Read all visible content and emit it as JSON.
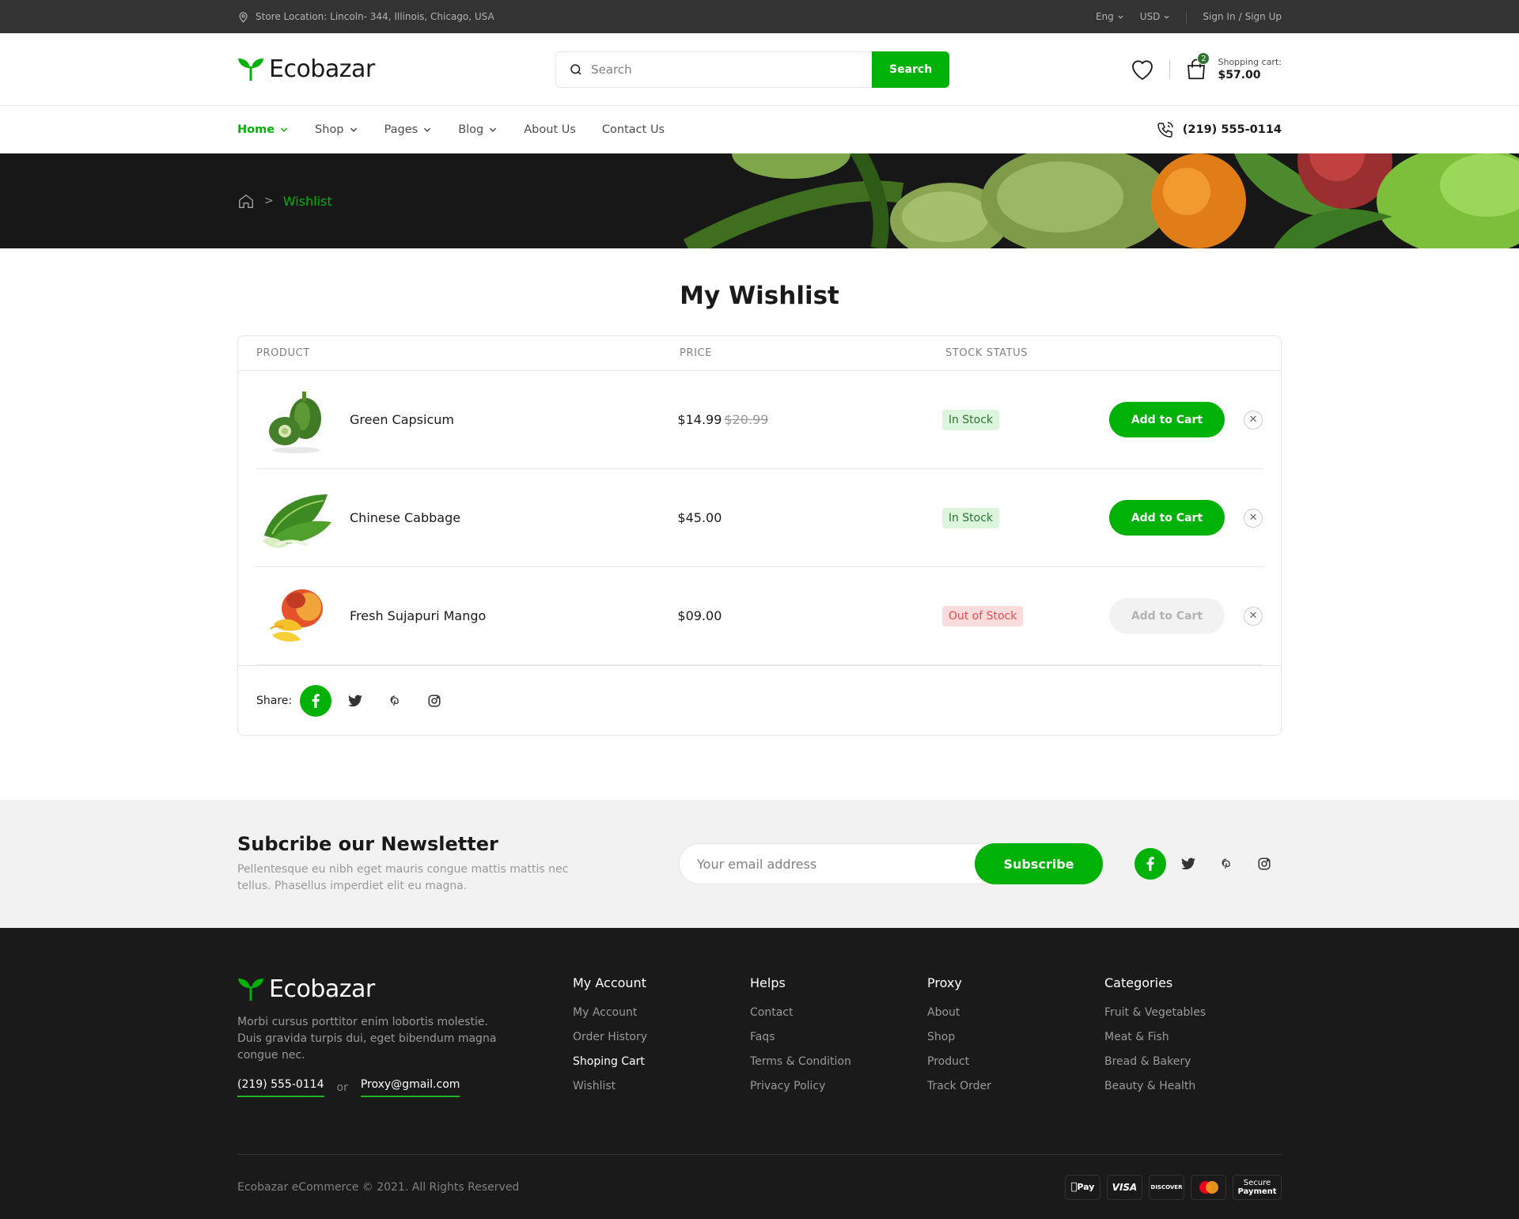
{
  "topbar": {
    "location": "Store Location: Lincoln- 344, Illinois, Chicago, USA",
    "language": "Eng",
    "currency": "USD",
    "sign_in": "Sign In",
    "slash": "/",
    "sign_up": "Sign Up"
  },
  "header": {
    "brand": "Ecobazar",
    "search_placeholder": "Search",
    "search_button": "Search",
    "cart_count": "2",
    "cart_label": "Shopping cart:",
    "cart_amount": "$57.00"
  },
  "nav": {
    "items": [
      {
        "label": "Home",
        "dropdown": true,
        "active": true
      },
      {
        "label": "Shop",
        "dropdown": true
      },
      {
        "label": "Pages",
        "dropdown": true
      },
      {
        "label": "Blog",
        "dropdown": true
      },
      {
        "label": "About Us",
        "dropdown": false
      },
      {
        "label": "Contact Us",
        "dropdown": false
      }
    ],
    "phone": "(219) 555-0114"
  },
  "breadcrumb": {
    "sep": ">",
    "current": "Wishlist"
  },
  "page_title": "My Wishlist",
  "table": {
    "columns": [
      "PRODUCT",
      "PRICE",
      "STOCK STATUS"
    ],
    "rows": [
      {
        "name": "Green Capsicum",
        "price": "$14.99",
        "old_price": "$20.99",
        "stock": "In Stock",
        "action": "Add to Cart"
      },
      {
        "name": "Chinese Cabbage",
        "price": "$45.00",
        "old_price": "",
        "stock": "In Stock",
        "action": "Add to Cart"
      },
      {
        "name": "Fresh Sujapuri Mango",
        "price": "$09.00",
        "old_price": "",
        "stock": "Out of Stock",
        "action": "Add to Cart"
      }
    ],
    "remove_glyph": "✕",
    "share_label": "Share:"
  },
  "newsletter": {
    "title": "Subcribe our Newsletter",
    "text": "Pellentesque eu nibh eget mauris congue mattis mattis nec tellus. Phasellus imperdiet elit eu magna.",
    "placeholder": "Your email address",
    "button": "Subscribe"
  },
  "footer": {
    "brand": "Ecobazar",
    "about": "Morbi cursus porttitor enim lobortis molestie. Duis gravida turpis dui, eget bibendum magna congue nec.",
    "phone": "(219) 555-0114",
    "or": "or",
    "email": "Proxy@gmail.com",
    "columns": [
      {
        "title": "My Account",
        "links": [
          "My Account",
          "Order History",
          "Shoping Cart",
          "Wishlist"
        ]
      },
      {
        "title": "Helps",
        "links": [
          "Contact",
          "Faqs",
          "Terms & Condition",
          "Privacy Policy"
        ]
      },
      {
        "title": "Proxy",
        "links": [
          "About",
          "Shop",
          "Product",
          "Track Order"
        ]
      },
      {
        "title": "Categories",
        "links": [
          "Fruit & Vegetables",
          "Meat & Fish",
          "Bread & Bakery",
          "Beauty & Health"
        ]
      }
    ],
    "copyright": "Ecobazar eCommerce © 2021. All Rights Reserved",
    "payments": [
      "Pay",
      "VISA",
      "DISCOVER",
      "",
      "Secure",
      "Payment"
    ]
  },
  "colors": {
    "accent": "#00b207",
    "dark": "#1a1a1a",
    "in_stock_bg": "#dcf5dd",
    "out_stock_bg": "#fbdcdc"
  }
}
